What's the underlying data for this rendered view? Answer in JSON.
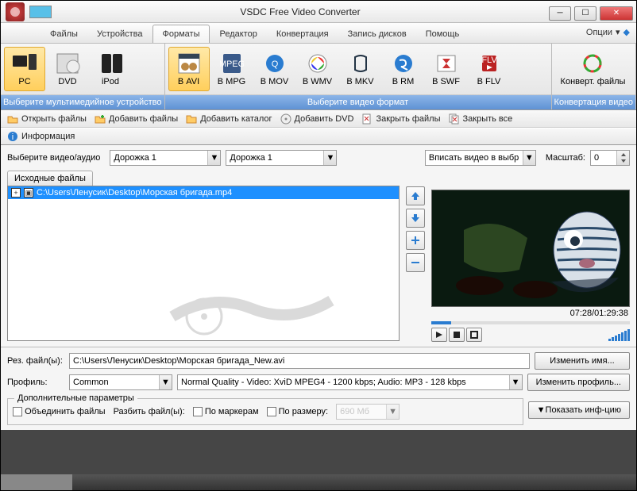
{
  "title": "VSDC Free Video Converter",
  "menubar": {
    "tabs": [
      "Файлы",
      "Устройства",
      "Форматы",
      "Редактор",
      "Конвертация",
      "Запись дисков",
      "Помощь"
    ],
    "active": 2,
    "options": "Опции"
  },
  "ribbon": {
    "devices": {
      "items": [
        {
          "label": "PC"
        },
        {
          "label": "DVD"
        },
        {
          "label": "iPod"
        }
      ],
      "selected": 0,
      "caption": "Выберите мультимедийное устройство"
    },
    "formats": {
      "items": [
        {
          "label": "В AVI"
        },
        {
          "label": "В MPG"
        },
        {
          "label": "В MOV"
        },
        {
          "label": "В WMV"
        },
        {
          "label": "В MKV"
        },
        {
          "label": "В RM"
        },
        {
          "label": "В SWF"
        },
        {
          "label": "В FLV"
        }
      ],
      "selected": 0,
      "caption": "Выберите видео формат"
    },
    "convert": {
      "label": "Конверт. файлы",
      "caption": "Конвертация видео"
    }
  },
  "toolbar": {
    "open": "Открыть файлы",
    "add": "Добавить файлы",
    "addcat": "Добавить каталог",
    "adddvd": "Добавить DVD",
    "close": "Закрыть файлы",
    "closeall": "Закрыть все",
    "info": "Информация"
  },
  "selectors": {
    "label": "Выберите видео/аудио",
    "track1": "Дорожка 1",
    "track2": "Дорожка 1",
    "fit": "Вписать видео в выбр",
    "zoom_label": "Масштаб:",
    "zoom": "0"
  },
  "filelist": {
    "header": "Исходные файлы",
    "file": "C:\\Users\\Ленусик\\Desktop\\Морская бригада.mp4"
  },
  "preview": {
    "time": "07:28/01:29:38"
  },
  "output": {
    "label": "Рез. файл(ы):",
    "path": "C:\\Users\\Ленусик\\Desktop\\Морская бригада_New.avi",
    "rename": "Изменить имя..."
  },
  "profile": {
    "label": "Профиль:",
    "preset": "Common",
    "quality": "Normal Quality - Video: XviD MPEG4 - 1200 kbps; Audio: MP3 - 128 kbps",
    "change": "Изменить профиль..."
  },
  "extra": {
    "legend": "Дополнительные параметры",
    "merge": "Объединить файлы",
    "split": "Разбить файл(ы):",
    "bymarkers": "По маркерам",
    "bysize": "По размеру:",
    "sizeval": "690 Мб",
    "showinfo": "Показать инф-цию"
  }
}
